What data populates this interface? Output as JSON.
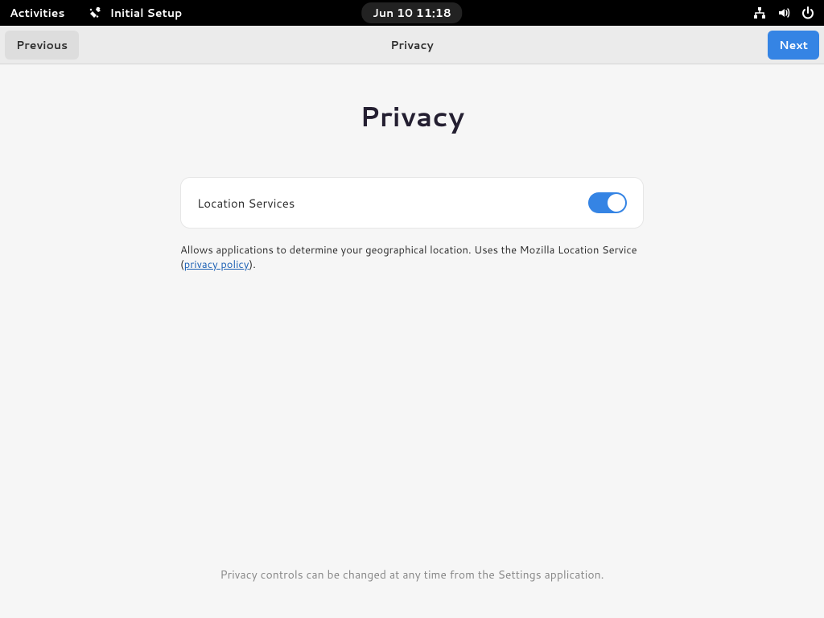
{
  "topbar": {
    "activities": "Activities",
    "app_name": "Initial Setup",
    "clock": "Jun 10  11:18"
  },
  "headerbar": {
    "previous": "Previous",
    "title": "Privacy",
    "next": "Next"
  },
  "page": {
    "title": "Privacy",
    "setting_label": "Location Services",
    "toggle_on": true,
    "description_before": "Allows applications to determine your geographical location. Uses the Mozilla Location Service (",
    "description_link": "privacy policy",
    "description_after": ").",
    "footer": "Privacy controls can be changed at any time from the Settings application."
  }
}
